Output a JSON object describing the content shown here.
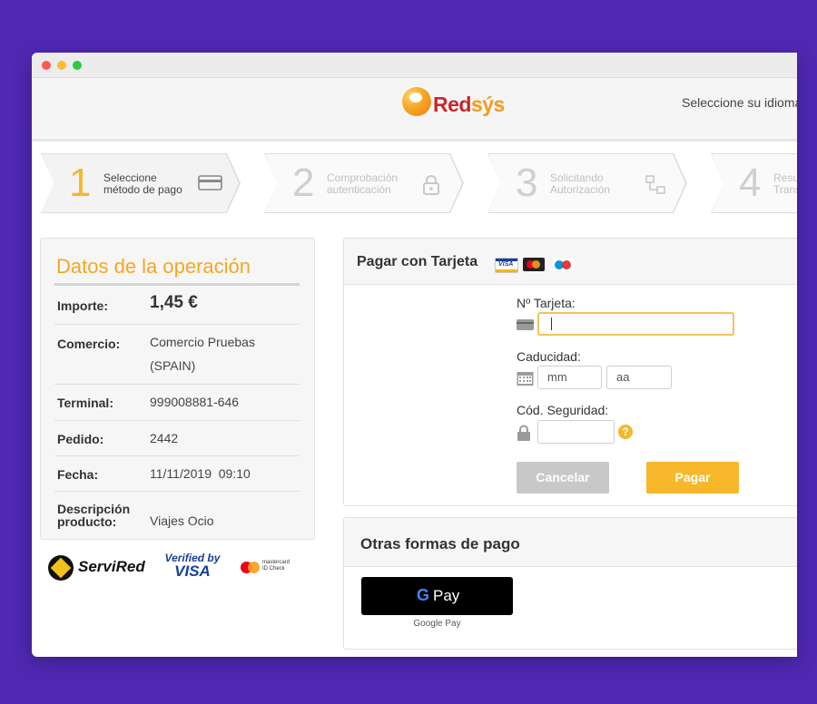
{
  "header": {
    "logo_text_main": "Red",
    "logo_text_accent": "sýs",
    "language_prompt": "Seleccione su idioma"
  },
  "steps": [
    {
      "number": "1",
      "label_line1": "Seleccione",
      "label_line2": "método de pago",
      "icon": "credit-card-icon",
      "active": true
    },
    {
      "number": "2",
      "label_line1": "Comprobación",
      "label_line2": "autenticación",
      "icon": "lock-icon",
      "active": false
    },
    {
      "number": "3",
      "label_line1": "Solicitando",
      "label_line2": "Autorización",
      "icon": "network-icon",
      "active": false
    },
    {
      "number": "4",
      "label_line1": "Resul",
      "label_line2": "Trans",
      "icon": "",
      "active": false
    }
  ],
  "operation": {
    "title": "Datos de la operación",
    "rows": [
      {
        "key": "Importe:",
        "value": "1,45 €"
      },
      {
        "key": "Comercio:",
        "value_line1": "Comercio Pruebas",
        "value_line2": "(SPAIN)"
      },
      {
        "key": "Terminal:",
        "value": "999008881-646"
      },
      {
        "key": "Pedido:",
        "value": "2442"
      },
      {
        "key": "Fecha:",
        "value": "11/11/2019  09:10"
      },
      {
        "key_line1": "Descripción",
        "key_line2": "producto:",
        "value": "Viajes Ocio"
      }
    ]
  },
  "brands": {
    "servired": "ServiRed",
    "vbv_line1": "Verified by",
    "vbv_line2": "VISA",
    "mc_line1": "mastercard",
    "mc_line2": "ID Check"
  },
  "card_payment": {
    "title": "Pagar con Tarjeta",
    "visa_label": "VISA",
    "card_number_label": "Nº Tarjeta:",
    "card_number_value": "",
    "expiry_label": "Caducidad:",
    "month_placeholder": "mm",
    "year_placeholder": "aa",
    "cvv_label": "Cód. Seguridad:",
    "help_symbol": "?",
    "cancel_label": "Cancelar",
    "pay_label": "Pagar"
  },
  "other_methods": {
    "title": "Otras formas de pago",
    "gpay_g": "G",
    "gpay_text": "Pay",
    "gpay_caption": "Google Pay"
  },
  "colors": {
    "background": "#4f28b3",
    "accent": "#f6b72b",
    "brand_red": "#c4282d"
  }
}
